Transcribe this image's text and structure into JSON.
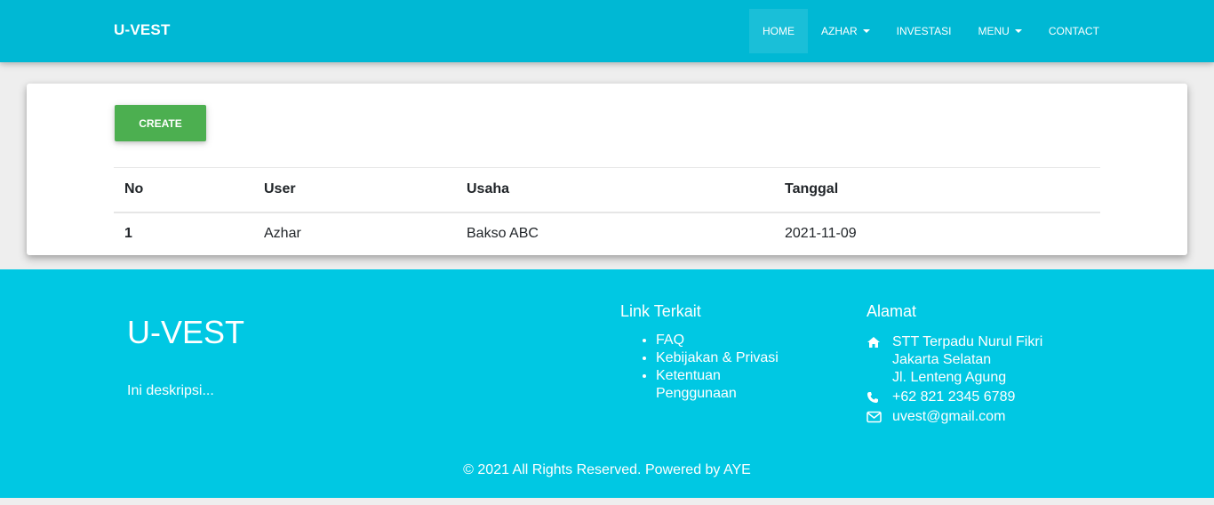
{
  "navbar": {
    "brand": "U-VEST",
    "items": [
      {
        "label": "Home",
        "active": true,
        "dropdown": false
      },
      {
        "label": "Azhar",
        "active": false,
        "dropdown": true
      },
      {
        "label": "Investasi",
        "active": false,
        "dropdown": false
      },
      {
        "label": "Menu",
        "active": false,
        "dropdown": true
      },
      {
        "label": "Contact",
        "active": false,
        "dropdown": false
      }
    ]
  },
  "main": {
    "create_label": "CREATE",
    "table": {
      "headers": [
        "No",
        "User",
        "Usaha",
        "Tanggal"
      ],
      "rows": [
        [
          "1",
          "Azhar",
          "Bakso ABC",
          "2021-11-09"
        ]
      ]
    }
  },
  "footer": {
    "brand": "U-VEST",
    "description": "Ini deskripsi...",
    "links_title": "Link Terkait",
    "links": [
      "FAQ",
      "Kebijakan & Privasi",
      "Ketentuan Penggunaan"
    ],
    "address_title": "Alamat",
    "address_lines": [
      "STT Terpadu Nurul Fikri",
      "Jakarta Selatan",
      "Jl. Lenteng Agung"
    ],
    "phone": "+62 821 2345 6789",
    "email": "uvest@gmail.com",
    "copyright": "© 2021 All Rights Reserved. Powered by AYE",
    "icons": [
      "home-icon",
      "phone-icon",
      "envelope-icon"
    ]
  },
  "colors": {
    "navbar": "#00b8d4",
    "footer": "#00c8e3",
    "create_button": "#4caf50",
    "background": "#eeeeee"
  }
}
